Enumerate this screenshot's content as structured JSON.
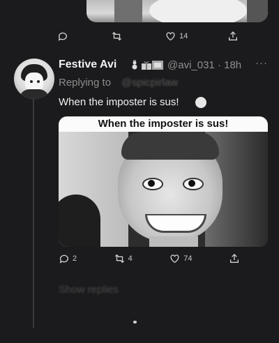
{
  "previous_tweet": {
    "actions": {
      "reply_count": "",
      "retweet_count": "",
      "like_count": "14"
    }
  },
  "tweet": {
    "author_name": "Festive Avi",
    "handle": "@avi_031",
    "time": "18h",
    "more_label": "···",
    "replying_label": "Replying to",
    "replying_user": "@spicpirlaw",
    "text": "When the imposter is sus!",
    "media_caption": "When the imposter is sus!",
    "actions": {
      "reply_count": "2",
      "retweet_count": "4",
      "like_count": "74"
    }
  },
  "show_replies_label": "Show replies",
  "icons": {
    "reply": "reply-icon",
    "retweet": "retweet-icon",
    "like": "heart-icon",
    "share": "share-icon"
  }
}
